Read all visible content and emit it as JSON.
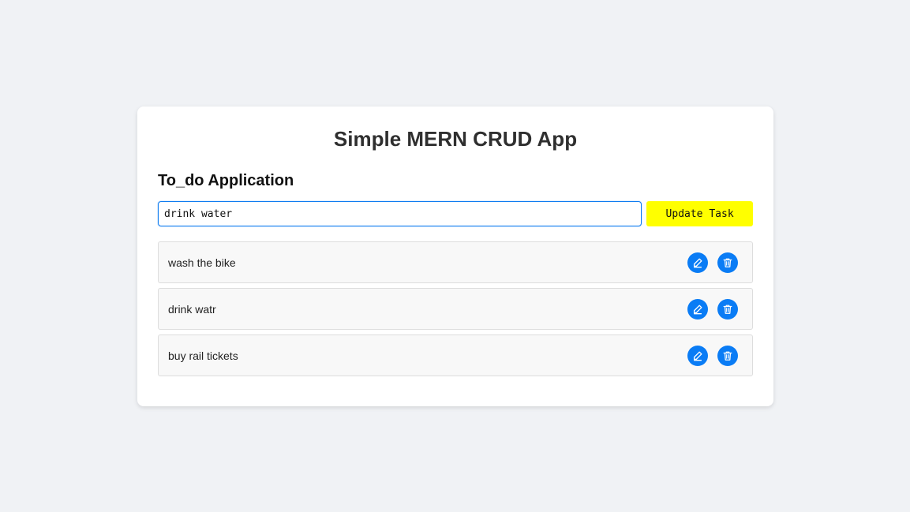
{
  "app": {
    "title": "Simple MERN CRUD App"
  },
  "todo": {
    "heading": "To_do Application",
    "input_value": "drink water",
    "update_button_label": "Update Task"
  },
  "tasks": [
    {
      "text": "wash the bike",
      "edit_icon": "pencil-icon",
      "delete_icon": "trash-icon"
    },
    {
      "text": "drink watr",
      "edit_icon": "pencil-icon",
      "delete_icon": "trash-icon"
    },
    {
      "text": "buy rail tickets",
      "edit_icon": "pencil-icon",
      "delete_icon": "trash-icon"
    }
  ],
  "colors": {
    "page_background": "#f0f2f5",
    "card_background": "#ffffff",
    "accent_blue": "#0a7cf5",
    "update_button_yellow": "#ffff00",
    "input_focus_border": "#0d7bf0"
  }
}
